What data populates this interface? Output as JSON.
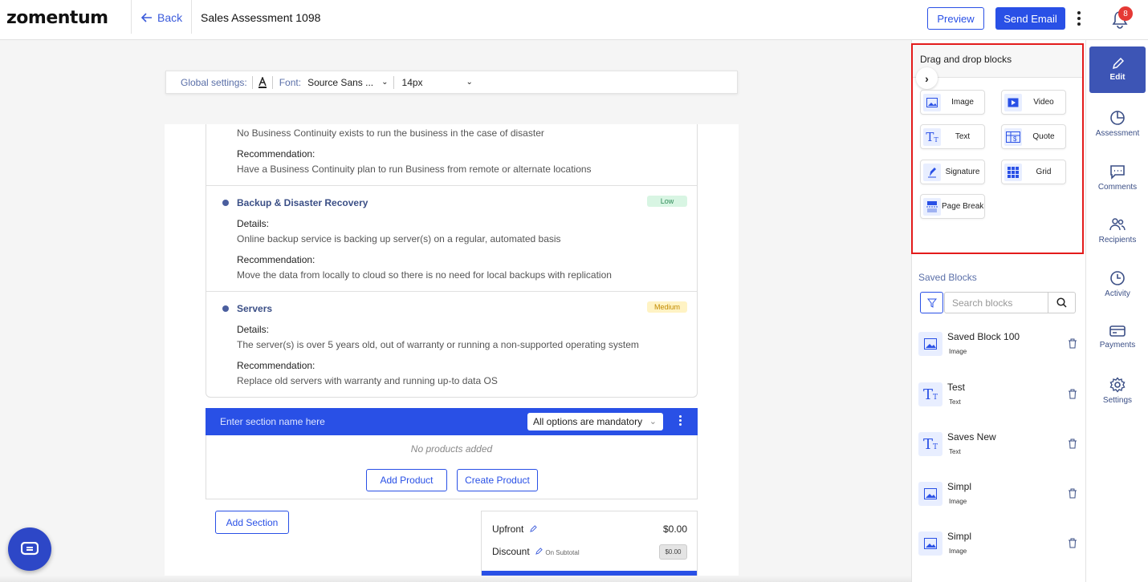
{
  "header": {
    "logo": "zomentum",
    "back_label": "Back",
    "doc_title": "Sales Assessment 1098",
    "preview_label": "Preview",
    "send_label": "Send Email",
    "notification_count": "8"
  },
  "global_settings": {
    "label": "Global settings:",
    "font_label": "Font:",
    "font_value": "Source Sans ...",
    "size_value": "14px"
  },
  "risks": [
    {
      "details": "No Business Continuity exists to run the business in the case of disaster",
      "recommendation_label": "Recommendation:",
      "recommendation": "Have a Business Continuity plan to run Business from remote or alternate locations"
    },
    {
      "title": "Backup & Disaster Recovery",
      "level": "Low",
      "details_label": "Details:",
      "details": "Online backup service is backing up server(s) on a regular, automated basis",
      "recommendation_label": "Recommendation:",
      "recommendation": "Move the data from locally to cloud so there is no need for local backups with replication"
    },
    {
      "title": "Servers",
      "level": "Medium",
      "details_label": "Details:",
      "details": "The server(s) is over 5 years old, out of warranty or running a non-supported operating system",
      "recommendation_label": "Recommendation:",
      "recommendation": "Replace old servers with warranty and running up-to data OS"
    }
  ],
  "section": {
    "name_placeholder": "Enter section name here",
    "options_value": "All options are mandatory",
    "no_products": "No products added",
    "add_product": "Add Product",
    "create_product": "Create Product",
    "add_section": "Add Section"
  },
  "totals": {
    "upfront_label": "Upfront",
    "upfront_value": "$0.00",
    "discount_label": "Discount",
    "discount_note": "On Subtotal",
    "discount_value": "$0.00"
  },
  "dnd": {
    "title": "Drag and drop blocks",
    "blocks": [
      {
        "label": "Image",
        "icon": "image-icon"
      },
      {
        "label": "Video",
        "icon": "video-icon"
      },
      {
        "label": "Text",
        "icon": "text-icon"
      },
      {
        "label": "Quote",
        "icon": "quote-icon"
      },
      {
        "label": "Signature",
        "icon": "signature-icon"
      },
      {
        "label": "Grid",
        "icon": "grid-icon"
      },
      {
        "label": "Page Break",
        "icon": "page-break-icon"
      }
    ]
  },
  "saved": {
    "title": "Saved Blocks",
    "search_placeholder": "Search blocks",
    "items": [
      {
        "name": "Saved Block 100",
        "type": "Image"
      },
      {
        "name": "Test",
        "type": "Text"
      },
      {
        "name": "Saves New",
        "type": "Text"
      },
      {
        "name": "Simpl",
        "type": "Image"
      },
      {
        "name": "Simpl",
        "type": "Image"
      }
    ]
  },
  "nav": {
    "items": [
      {
        "label": "Edit",
        "icon": "pencil-icon",
        "active": true
      },
      {
        "label": "Assessment",
        "icon": "pie-chart-icon"
      },
      {
        "label": "Comments",
        "icon": "comment-icon"
      },
      {
        "label": "Recipients",
        "icon": "users-icon"
      },
      {
        "label": "Activity",
        "icon": "clock-icon"
      },
      {
        "label": "Payments",
        "icon": "card-icon"
      },
      {
        "label": "Settings",
        "icon": "gear-icon"
      }
    ]
  },
  "colors": {
    "brand_blue": "#2950e6",
    "nav_active": "#3d55b5",
    "highlight_frame": "#e31b1b"
  }
}
